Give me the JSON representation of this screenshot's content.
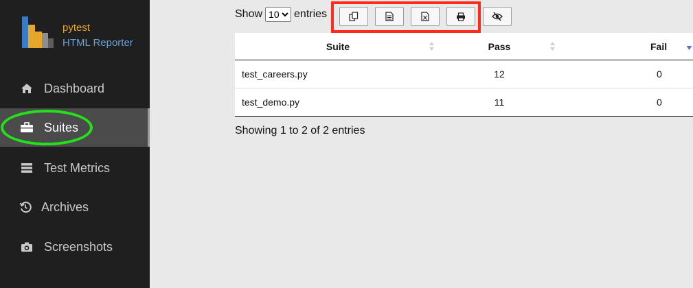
{
  "sidebar": {
    "logo": {
      "line1": "pytest",
      "line2": "HTML Reporter"
    },
    "items": [
      {
        "label": "Dashboard",
        "icon": "home-icon"
      },
      {
        "label": "Suites",
        "icon": "briefcase-icon",
        "active": true
      },
      {
        "label": "Test Metrics",
        "icon": "server-icon"
      },
      {
        "label": "Archives",
        "icon": "history-icon"
      },
      {
        "label": "Screenshots",
        "icon": "camera-icon"
      }
    ]
  },
  "toolbar": {
    "show_label": "Show",
    "entries_value": "10",
    "entries_options": [
      "10"
    ],
    "entries_label": "entries",
    "buttons": [
      "copy-icon",
      "csv-icon",
      "excel-icon",
      "print-icon",
      "column-visibility-icon"
    ]
  },
  "table": {
    "headers": [
      "Suite",
      "Pass",
      "Fail"
    ],
    "rows": [
      [
        "test_careers.py",
        "12",
        "0"
      ],
      [
        "test_demo.py",
        "11",
        "0"
      ]
    ]
  },
  "info": "Showing 1 to 2 of 2 entries",
  "colors": {
    "sidebar_bg": "#1f1f1f",
    "active_bg": "#4b4b4b",
    "highlight_red": "#ff2a1a",
    "highlight_green": "#22e21a",
    "sort_active": "#5b6fd6"
  }
}
